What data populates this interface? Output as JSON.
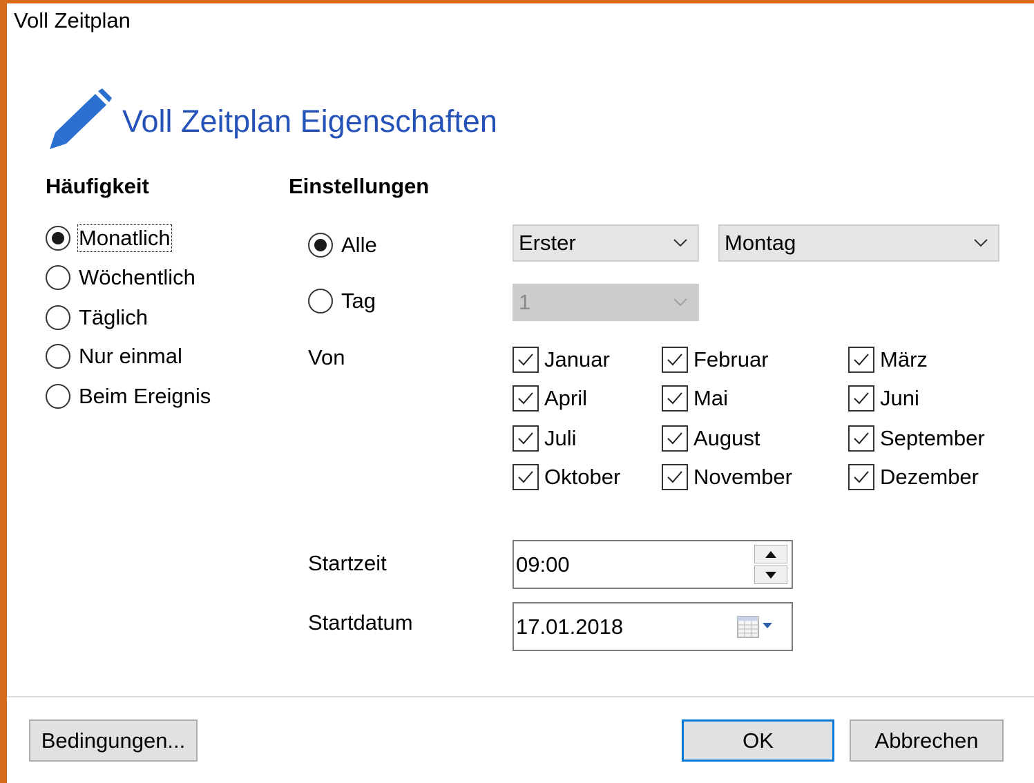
{
  "window": {
    "title": "Voll Zeitplan"
  },
  "dialog": {
    "heading": "Voll Zeitplan Eigenschaften",
    "heading_color": "#2452b8",
    "icon": "pencil-icon"
  },
  "frequency": {
    "title": "Häufigkeit",
    "options": [
      "Monatlich",
      "Wöchentlich",
      "Täglich",
      "Nur einmal",
      "Beim Ereignis"
    ],
    "selected": "Monatlich"
  },
  "settings": {
    "title": "Einstellungen",
    "mode_all_label": "Alle",
    "mode_day_label": "Tag",
    "mode_selected": "Alle",
    "occurrence_value": "Erster",
    "weekday_value": "Montag",
    "day_value": "1",
    "months_label": "Von",
    "months": [
      {
        "name": "Januar",
        "checked": true
      },
      {
        "name": "Februar",
        "checked": true
      },
      {
        "name": "März",
        "checked": true
      },
      {
        "name": "April",
        "checked": true
      },
      {
        "name": "Mai",
        "checked": true
      },
      {
        "name": "Juni",
        "checked": true
      },
      {
        "name": "Juli",
        "checked": true
      },
      {
        "name": "August",
        "checked": true
      },
      {
        "name": "September",
        "checked": true
      },
      {
        "name": "Oktober",
        "checked": true
      },
      {
        "name": "November",
        "checked": true
      },
      {
        "name": "Dezember",
        "checked": true
      }
    ],
    "start_time_label": "Startzeit",
    "start_time_value": "09:00",
    "start_date_label": "Startdatum",
    "start_date_value": "17.01.2018"
  },
  "buttons": {
    "conditions": "Bedingungen...",
    "ok": "OK",
    "cancel": "Abbrechen"
  },
  "colors": {
    "frame": "#d86b1a",
    "accent": "#0078d7"
  }
}
